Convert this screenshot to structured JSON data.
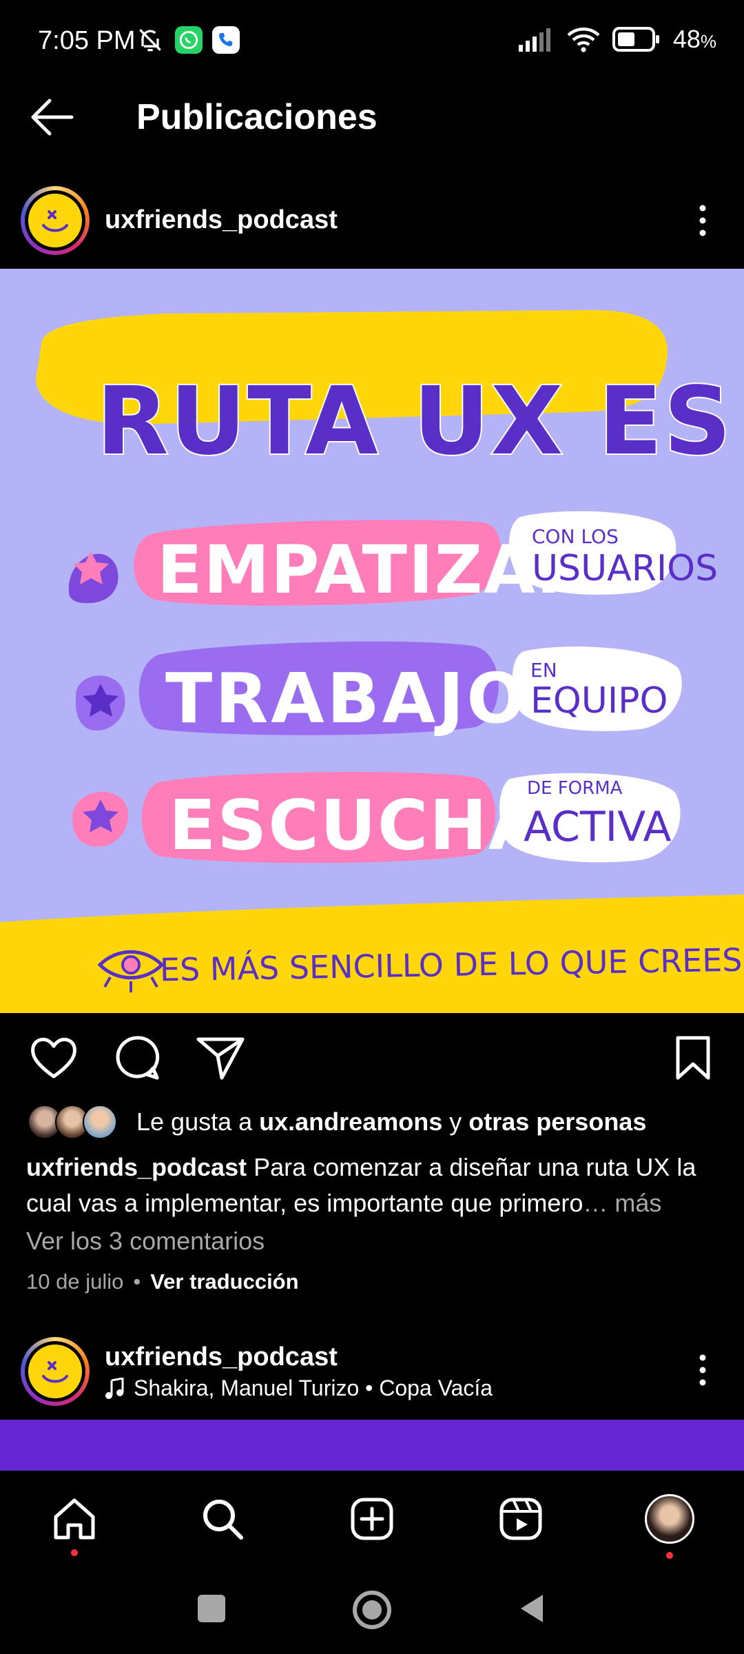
{
  "status_bar": {
    "time": "7:05 PM",
    "battery": "48",
    "battery_unit": "%",
    "icons": [
      "muted-bell-icon",
      "whatsapp-icon",
      "phone-app-icon",
      "signal-icon",
      "wifi-icon",
      "battery-icon"
    ]
  },
  "header": {
    "title": "Publicaciones"
  },
  "post": {
    "username": "uxfriends_podcast",
    "image": {
      "title": "RUTA UX ES",
      "items": [
        {
          "word": "EMPATIZAR",
          "small": "CON LOS",
          "big": "USUARIOS"
        },
        {
          "word": "TRABAJO",
          "small": "EN",
          "big": "EQUIPO"
        },
        {
          "word": "ESCUCHAR",
          "small": "DE FORMA",
          "big": "ACTIVA"
        }
      ],
      "footer": "ES MÁS SENCILLO DE LO QUE CREES..."
    },
    "likes_prefix": "Le gusta a ",
    "likes_user": "ux.andreamons",
    "likes_mid": " y ",
    "likes_others": "otras personas",
    "caption_user": "uxfriends_podcast",
    "caption_text": " Para comenzar a diseñar una ruta UX la cual vas a implementar, es importante que primero",
    "caption_more": "… más",
    "comments_link": "Ver los 3 comentarios",
    "date": "10 de julio",
    "translate": "Ver traducción"
  },
  "post2": {
    "username": "uxfriends_podcast",
    "music": "Shakira, Manuel Turizo • Copa Vacía"
  },
  "colors": {
    "image_bg": "#b5b3f7",
    "yellow": "#ffd60a",
    "pink": "#ff7eb9",
    "purple": "#5a2fc8",
    "violet": "#9a6cf0",
    "strip": "#6527d4"
  }
}
